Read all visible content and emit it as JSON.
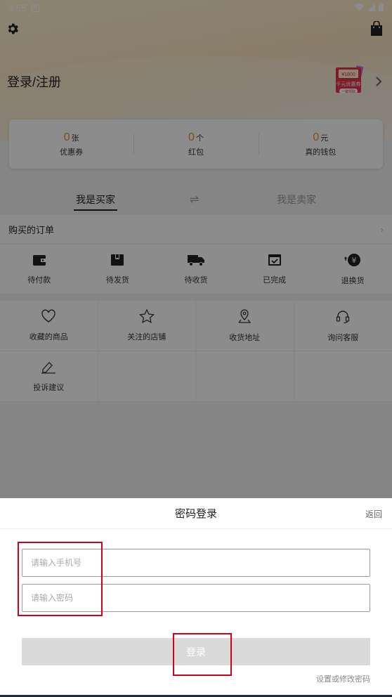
{
  "status_bar": {
    "time": "3:55",
    "notification_badge": "A"
  },
  "header": {
    "login_register": "登录/注册",
    "promo": {
      "amount": "¥1800",
      "title": "千元优惠券",
      "cta": "一键领取"
    }
  },
  "wallet": [
    {
      "value": "0",
      "unit": "张",
      "label": "优惠券"
    },
    {
      "value": "0",
      "unit": "个",
      "label": "红包"
    },
    {
      "value": "0",
      "unit": "元",
      "label": "真的钱包"
    }
  ],
  "roles": {
    "buyer": "我是买家",
    "seller": "我是卖家",
    "swap_icon": "⇌"
  },
  "orders": {
    "title": "购买的订单",
    "chevron": "›"
  },
  "order_status": [
    {
      "label": "待付款",
      "icon": "wallet-icon"
    },
    {
      "label": "待发货",
      "icon": "box-icon"
    },
    {
      "label": "待收货",
      "icon": "truck-icon"
    },
    {
      "label": "已完成",
      "icon": "check-calendar-icon"
    },
    {
      "label": "退换货",
      "icon": "yuan-refund-icon"
    }
  ],
  "services": [
    {
      "label": "收藏的商品",
      "icon": "heart-icon"
    },
    {
      "label": "关注的店铺",
      "icon": "star-icon"
    },
    {
      "label": "收货地址",
      "icon": "location-icon"
    },
    {
      "label": "询问客服",
      "icon": "headset-icon"
    },
    {
      "label": "投诉建议",
      "icon": "feedback-icon"
    }
  ],
  "login_sheet": {
    "title": "密码登录",
    "back": "返回",
    "phone_placeholder": "请输入手机号",
    "password_placeholder": "请输入密码",
    "submit": "登录",
    "reset_password": "设置或修改密码"
  },
  "colors": {
    "accent_orange": "#e0902a",
    "highlight_red": "#d0021b",
    "disabled_button": "#dadada"
  }
}
